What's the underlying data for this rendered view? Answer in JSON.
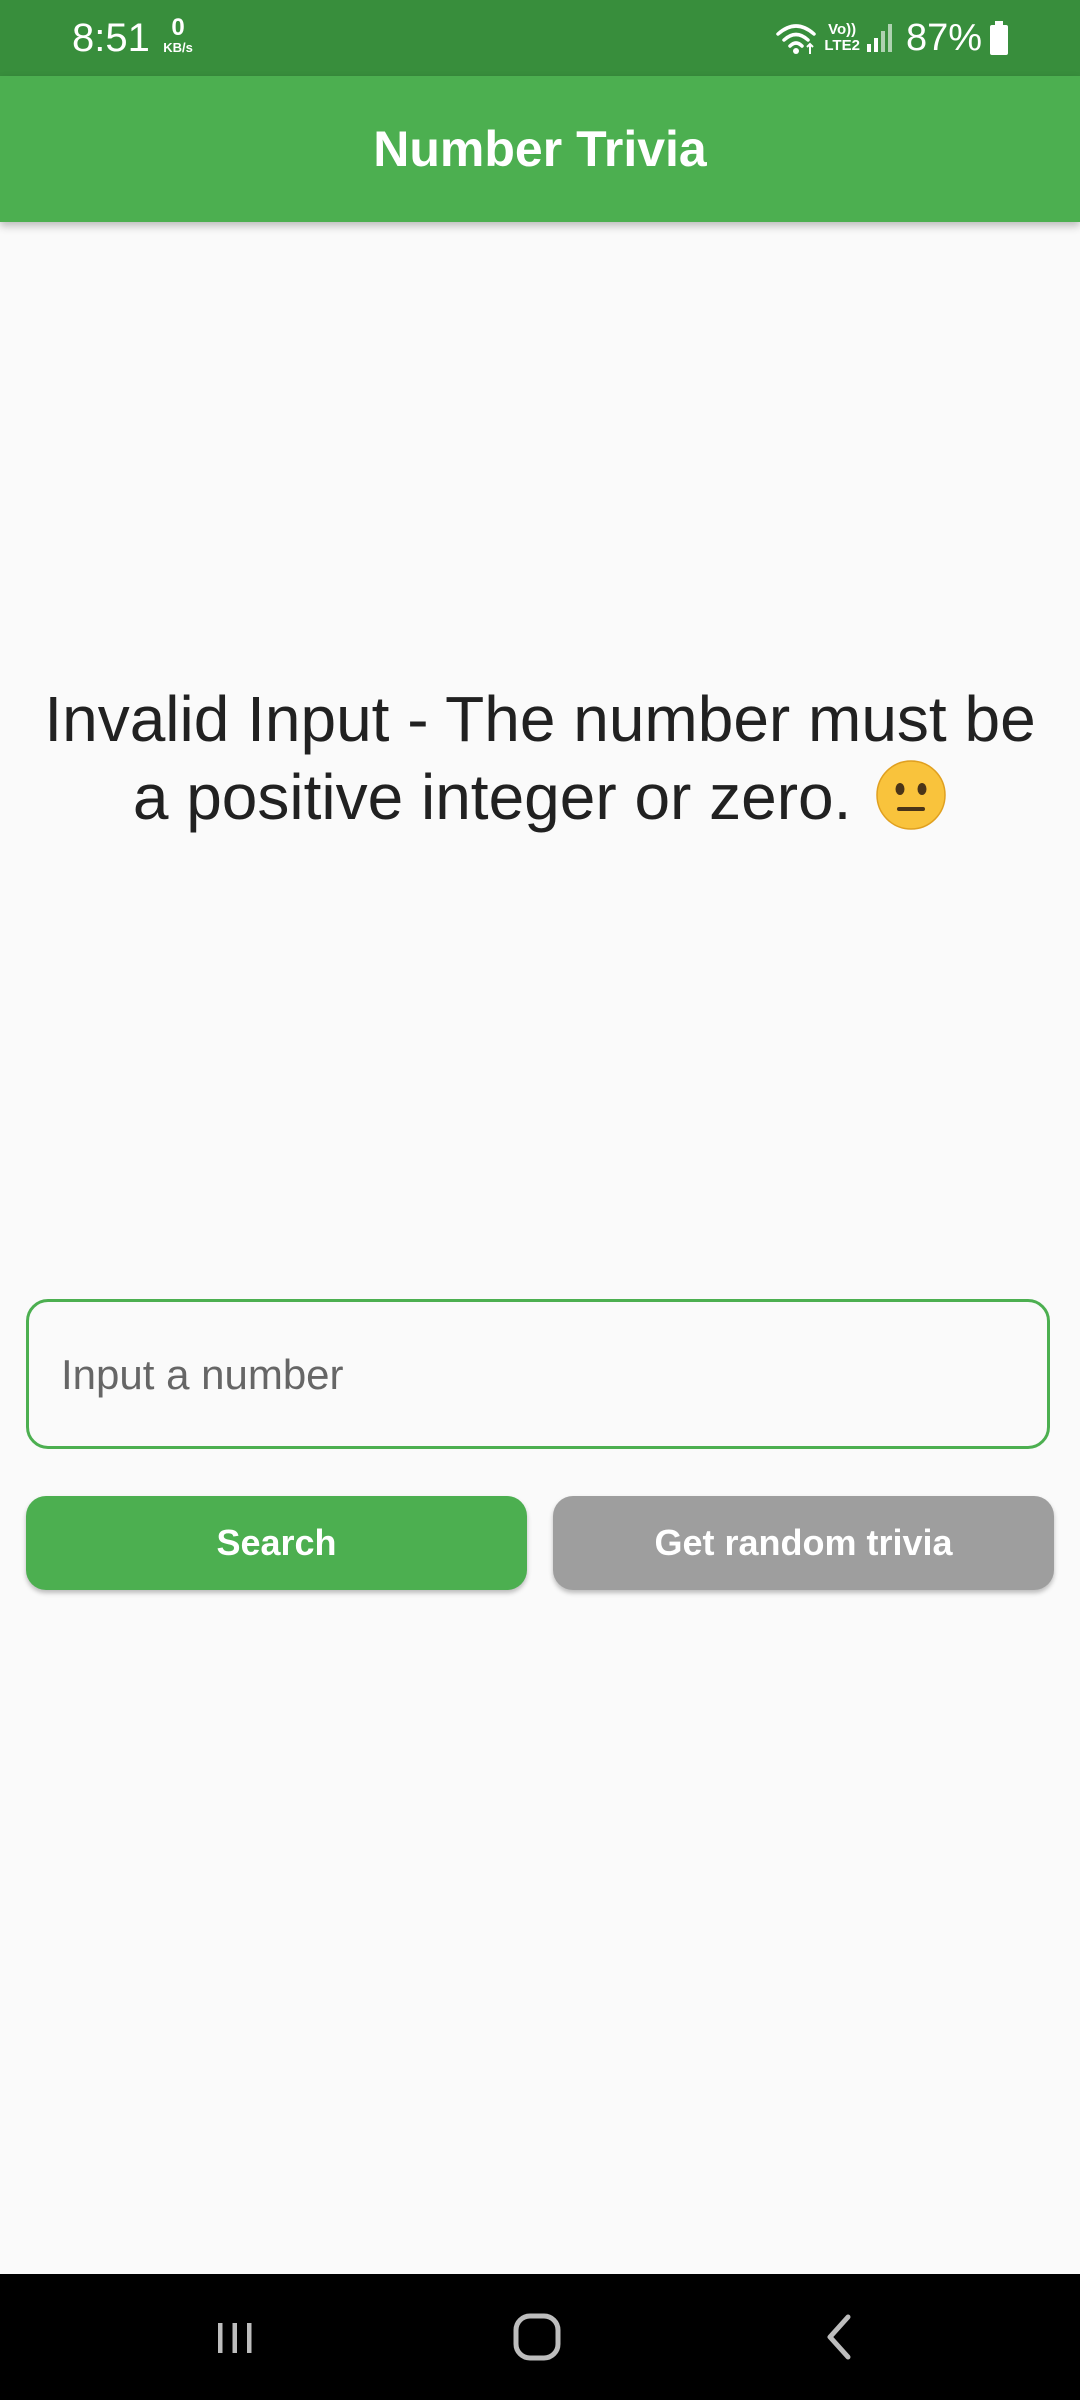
{
  "status_bar": {
    "time": "8:51",
    "net_speed_value": "0",
    "net_speed_unit": "KB/s",
    "lte_top": "Vo))",
    "lte_bottom": "LTE2",
    "battery_percent": "87%",
    "icons": [
      "wifi-icon",
      "lte-icon",
      "signal-icon",
      "battery-icon"
    ]
  },
  "app_bar": {
    "title": "Number Trivia"
  },
  "main": {
    "message": "Invalid Input - The number must be a positive integer or zero.",
    "message_emoji": "neutral-face-emoji",
    "input": {
      "placeholder": "Input a number",
      "value": ""
    },
    "search_button_label": "Search",
    "random_button_label": "Get random trivia"
  },
  "nav_bar": {
    "icons": [
      "recent-apps-icon",
      "home-icon",
      "back-icon"
    ]
  },
  "colors": {
    "status_bar": "#388e3c",
    "primary": "#4caf50",
    "secondary_button": "#9e9e9e",
    "background": "#fafafa"
  }
}
